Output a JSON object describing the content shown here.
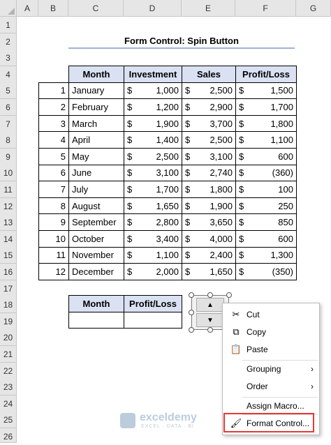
{
  "columns": [
    "A",
    "B",
    "C",
    "D",
    "E",
    "F",
    "G"
  ],
  "rows": [
    "1",
    "2",
    "3",
    "4",
    "5",
    "6",
    "7",
    "8",
    "9",
    "10",
    "11",
    "12",
    "13",
    "14",
    "15",
    "16",
    "17",
    "18",
    "19",
    "20",
    "21",
    "22",
    "23",
    "24",
    "25",
    "26"
  ],
  "title": "Form Control: Spin Button",
  "table": {
    "headers": [
      "Month",
      "Investment",
      "Sales",
      "Profit/Loss"
    ],
    "currency": "$",
    "rows": [
      {
        "n": "1",
        "month": "January",
        "inv": "1,000",
        "sales": "2,500",
        "pl": "1,500"
      },
      {
        "n": "2",
        "month": "February",
        "inv": "1,200",
        "sales": "2,900",
        "pl": "1,700"
      },
      {
        "n": "3",
        "month": "March",
        "inv": "1,900",
        "sales": "3,700",
        "pl": "1,800"
      },
      {
        "n": "4",
        "month": "April",
        "inv": "1,400",
        "sales": "2,500",
        "pl": "1,100"
      },
      {
        "n": "5",
        "month": "May",
        "inv": "2,500",
        "sales": "3,100",
        "pl": "600"
      },
      {
        "n": "6",
        "month": "June",
        "inv": "3,100",
        "sales": "2,740",
        "pl": "(360)"
      },
      {
        "n": "7",
        "month": "July",
        "inv": "1,700",
        "sales": "1,800",
        "pl": "100"
      },
      {
        "n": "8",
        "month": "August",
        "inv": "1,650",
        "sales": "1,900",
        "pl": "250"
      },
      {
        "n": "9",
        "month": "September",
        "inv": "2,800",
        "sales": "3,650",
        "pl": "850"
      },
      {
        "n": "10",
        "month": "October",
        "inv": "3,400",
        "sales": "4,000",
        "pl": "600"
      },
      {
        "n": "11",
        "month": "November",
        "inv": "1,100",
        "sales": "2,400",
        "pl": "1,300"
      },
      {
        "n": "12",
        "month": "December",
        "inv": "2,000",
        "sales": "1,650",
        "pl": "(350)"
      }
    ]
  },
  "small_table": {
    "headers": [
      "Month",
      "Profit/Loss"
    ]
  },
  "context_menu": {
    "items": [
      {
        "label": "Cut",
        "icon": "scissors-icon"
      },
      {
        "label": "Copy",
        "icon": "copy-icon"
      },
      {
        "label": "Paste",
        "icon": "paste-icon"
      },
      {
        "label": "Grouping",
        "submenu": true
      },
      {
        "label": "Order",
        "submenu": true
      },
      {
        "label": "Assign Macro..."
      },
      {
        "label": "Format Control...",
        "icon": "format-control-icon"
      }
    ]
  },
  "watermark": {
    "name": "exceldemy",
    "sub": "EXCEL · DATA · BI"
  },
  "colors": {
    "header_fill": "#d9e1f2",
    "highlight": "#e53935",
    "grid_header": "#e6e6e6"
  }
}
